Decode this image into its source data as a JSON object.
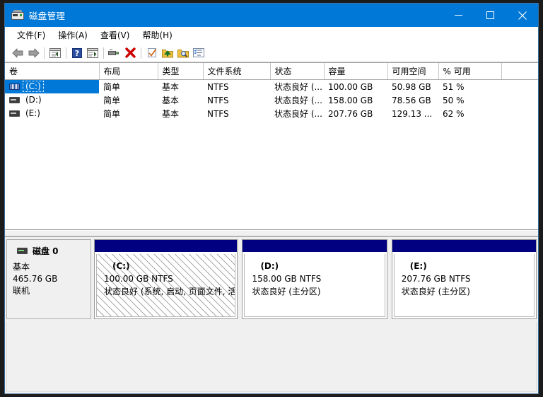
{
  "window": {
    "title": "磁盘管理",
    "icon": "disk-management-icon",
    "minimize_label": "最小化",
    "maximize_label": "最大化",
    "close_label": "关闭"
  },
  "menu": {
    "items": [
      {
        "label": "文件(F)",
        "name": "menu-file"
      },
      {
        "label": "操作(A)",
        "name": "menu-action"
      },
      {
        "label": "查看(V)",
        "name": "menu-view"
      },
      {
        "label": "帮助(H)",
        "name": "menu-help"
      }
    ]
  },
  "toolbar": {
    "buttons": [
      {
        "name": "back-icon",
        "title": "后退"
      },
      {
        "name": "forward-icon",
        "title": "前进"
      },
      {
        "name": "show-hide-console-tree-icon",
        "title": "显示/隐藏控制台树"
      },
      {
        "name": "help-icon",
        "title": "帮助"
      },
      {
        "name": "show-hide-action-pane-icon",
        "title": "显示/隐藏操作窗格"
      },
      {
        "name": "properties-icon",
        "title": "属性"
      },
      {
        "name": "delete-icon",
        "title": "删除"
      },
      {
        "name": "refresh-icon",
        "title": "刷新"
      },
      {
        "name": "rescan-disks-icon",
        "title": "重新扫描磁盘"
      },
      {
        "name": "search-icon",
        "title": "查找"
      },
      {
        "name": "list-view-icon",
        "title": "列表"
      }
    ]
  },
  "volume_table": {
    "columns": [
      {
        "label": "卷",
        "width": 133
      },
      {
        "label": "布局",
        "width": 83
      },
      {
        "label": "类型",
        "width": 64
      },
      {
        "label": "文件系统",
        "width": 95
      },
      {
        "label": "状态",
        "width": 76
      },
      {
        "label": "容量",
        "width": 90
      },
      {
        "label": "可用空间",
        "width": 72
      },
      {
        "label": "% 可用",
        "width": 89
      },
      {
        "label": "",
        "width": 54
      }
    ],
    "rows": [
      {
        "selected": true,
        "icon": "system-volume-icon",
        "volume": "(C:)",
        "layout": "简单",
        "type": "基本",
        "filesystem": "NTFS",
        "status": "状态良好 (...",
        "capacity": "100.00 GB",
        "free": "50.98 GB",
        "percent_free": "51 %"
      },
      {
        "selected": false,
        "icon": "volume-icon",
        "volume": "(D:)",
        "layout": "简单",
        "type": "基本",
        "filesystem": "NTFS",
        "status": "状态良好 (...",
        "capacity": "158.00 GB",
        "free": "78.56 GB",
        "percent_free": "50 %"
      },
      {
        "selected": false,
        "icon": "volume-icon",
        "volume": "(E:)",
        "layout": "简单",
        "type": "基本",
        "filesystem": "NTFS",
        "status": "状态良好 (...",
        "capacity": "207.76 GB",
        "free": "129.13 ...",
        "percent_free": "62 %"
      }
    ]
  },
  "disk_panel": {
    "disk": {
      "icon": "disk-icon",
      "name": "磁盘 0",
      "type": "基本",
      "size": "465.76 GB",
      "status": "联机"
    },
    "partitions": [
      {
        "name": "(C:)",
        "size_fs": "100.00 GB NTFS",
        "status": "状态良好 (系统, 启动, 页面文件, 活",
        "hatched": true,
        "width_pct": 32.5,
        "bar_color": "#000080"
      },
      {
        "name": "(D:)",
        "size_fs": "158.00 GB NTFS",
        "status": "状态良好 (主分区)",
        "hatched": false,
        "width_pct": 32.8,
        "bar_color": "#000080"
      },
      {
        "name": "(E:)",
        "size_fs": "207.76 GB NTFS",
        "status": "状态良好 (主分区)",
        "hatched": false,
        "width_pct": 34.7,
        "bar_color": "#000080"
      }
    ]
  },
  "colors": {
    "titlebar": "#0078d7",
    "selection": "#0078d7",
    "partition_bar": "#000080",
    "window_bg": "#f0f0f0"
  }
}
